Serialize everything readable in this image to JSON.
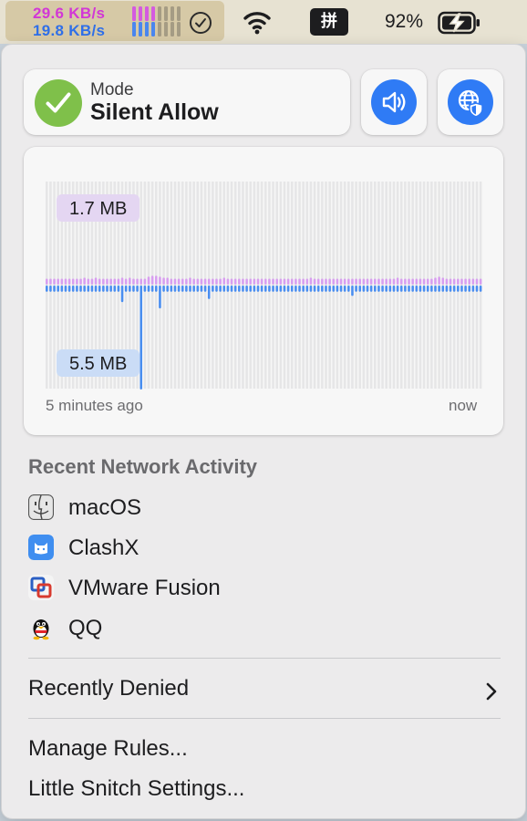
{
  "menubar": {
    "upload_rate": "29.6 KB/s",
    "download_rate": "19.8 KB/s",
    "upload_color": "#d237d6",
    "download_color": "#2f6fe8",
    "meter_upload_levels": [
      1,
      1,
      1,
      1,
      0,
      0,
      0,
      0
    ],
    "meter_download_levels": [
      1,
      1,
      1,
      1,
      0,
      0,
      0,
      0
    ],
    "status_icon": "check-circle-icon",
    "wifi_icon": "wifi-icon",
    "input_method": "拼",
    "battery_percent": "92%",
    "battery_icon": "battery-charging-icon"
  },
  "mode": {
    "label": "Mode",
    "value": "Silent Allow",
    "icon": "check-icon",
    "icon_color": "#7fc04a"
  },
  "buttons": {
    "sound": "speaker-icon",
    "network": "globe-shield-icon",
    "accent": "#2f7bf5"
  },
  "traffic": {
    "peak_upload": "1.7 MB",
    "peak_download": "5.5 MB",
    "start_label": "5 minutes ago",
    "end_label": "now",
    "upload_color": "#d89ef0",
    "download_color": "#4a8ef0",
    "upload_levels": [
      0.06,
      0.06,
      0.06,
      0.06,
      0.06,
      0.06,
      0.06,
      0.06,
      0.06,
      0.06,
      0.07,
      0.06,
      0.06,
      0.07,
      0.06,
      0.06,
      0.06,
      0.06,
      0.06,
      0.06,
      0.07,
      0.06,
      0.07,
      0.06,
      0.06,
      0.06,
      0.06,
      0.08,
      0.09,
      0.09,
      0.08,
      0.07,
      0.07,
      0.06,
      0.06,
      0.06,
      0.06,
      0.06,
      0.07,
      0.06,
      0.06,
      0.06,
      0.06,
      0.06,
      0.06,
      0.06,
      0.06,
      0.07,
      0.06,
      0.06,
      0.06,
      0.06,
      0.06,
      0.06,
      0.06,
      0.06,
      0.06,
      0.06,
      0.06,
      0.06,
      0.06,
      0.06,
      0.06,
      0.06,
      0.06,
      0.06,
      0.06,
      0.06,
      0.06,
      0.06,
      0.07,
      0.06,
      0.06,
      0.06,
      0.06,
      0.06,
      0.06,
      0.06,
      0.06,
      0.06,
      0.06,
      0.06,
      0.06,
      0.06,
      0.06,
      0.06,
      0.06,
      0.06,
      0.06,
      0.06,
      0.06,
      0.06,
      0.06,
      0.07,
      0.06,
      0.06,
      0.06,
      0.06,
      0.06,
      0.06,
      0.06,
      0.06,
      0.06,
      0.07,
      0.08,
      0.07,
      0.06,
      0.06,
      0.06,
      0.06,
      0.06,
      0.06,
      0.06,
      0.06,
      0.06,
      0.06
    ],
    "download_levels": [
      0.06,
      0.06,
      0.06,
      0.06,
      0.06,
      0.06,
      0.06,
      0.06,
      0.06,
      0.06,
      0.06,
      0.06,
      0.06,
      0.06,
      0.06,
      0.06,
      0.06,
      0.06,
      0.06,
      0.06,
      0.16,
      0.06,
      0.06,
      0.06,
      0.06,
      1.0,
      0.06,
      0.06,
      0.06,
      0.06,
      0.22,
      0.06,
      0.06,
      0.06,
      0.06,
      0.06,
      0.06,
      0.06,
      0.06,
      0.06,
      0.06,
      0.06,
      0.06,
      0.13,
      0.06,
      0.06,
      0.06,
      0.06,
      0.06,
      0.06,
      0.06,
      0.06,
      0.06,
      0.06,
      0.06,
      0.06,
      0.06,
      0.06,
      0.06,
      0.06,
      0.06,
      0.06,
      0.06,
      0.06,
      0.06,
      0.06,
      0.06,
      0.06,
      0.06,
      0.06,
      0.06,
      0.06,
      0.06,
      0.06,
      0.06,
      0.06,
      0.06,
      0.06,
      0.06,
      0.06,
      0.06,
      0.1,
      0.06,
      0.06,
      0.06,
      0.06,
      0.06,
      0.06,
      0.06,
      0.06,
      0.06,
      0.06,
      0.06,
      0.06,
      0.06,
      0.06,
      0.06,
      0.06,
      0.06,
      0.06,
      0.06,
      0.06,
      0.06,
      0.06,
      0.06,
      0.06,
      0.06,
      0.06,
      0.06,
      0.06,
      0.06,
      0.06,
      0.06,
      0.06,
      0.06,
      0.06
    ]
  },
  "recent": {
    "heading": "Recent Network Activity",
    "apps": [
      {
        "name": "macOS",
        "icon": "finder-icon"
      },
      {
        "name": "ClashX",
        "icon": "clashx-icon"
      },
      {
        "name": "VMware Fusion",
        "icon": "vmware-icon"
      },
      {
        "name": "QQ",
        "icon": "qq-icon"
      }
    ]
  },
  "menu": {
    "recently_denied": "Recently Denied",
    "manage_rules": "Manage Rules...",
    "settings": "Little Snitch Settings..."
  }
}
